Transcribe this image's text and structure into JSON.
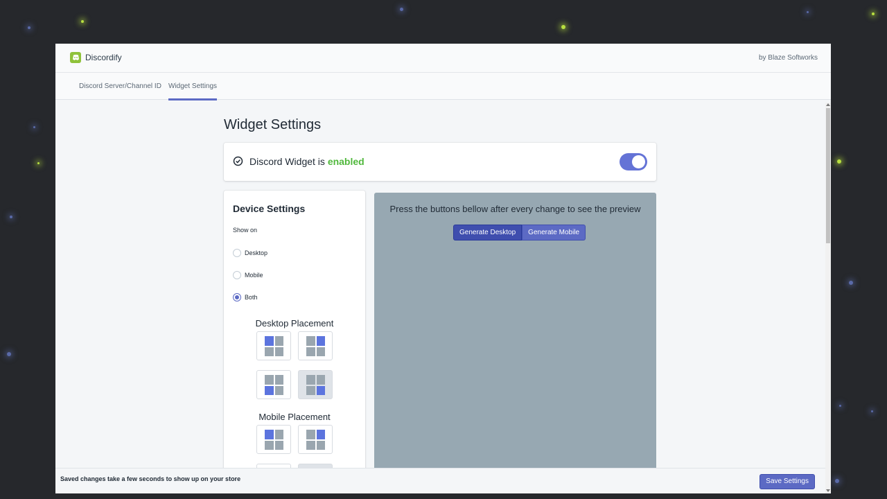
{
  "header": {
    "app_name": "Discordify",
    "app_icon": "discord-logo-icon",
    "byline": "by Blaze Softworks"
  },
  "tabs": [
    {
      "label": "Discord Server/Channel ID",
      "active": false
    },
    {
      "label": "Widget Settings",
      "active": true
    }
  ],
  "page": {
    "title": "Widget Settings"
  },
  "status": {
    "icon": "check-circle-icon",
    "prefix": "Discord Widget is",
    "value": "enabled",
    "value_color": "#50b83c",
    "toggle_on": true
  },
  "device_settings": {
    "title": "Device Settings",
    "show_on_label": "Show on",
    "options": [
      {
        "label": "Desktop",
        "checked": false
      },
      {
        "label": "Mobile",
        "checked": false
      },
      {
        "label": "Both",
        "checked": true
      }
    ],
    "desktop_placement_title": "Desktop Placement",
    "mobile_placement_title": "Mobile Placement",
    "desktop_placements": [
      {
        "name": "top-left",
        "selected": false
      },
      {
        "name": "top-right",
        "selected": false
      },
      {
        "name": "bottom-left",
        "selected": false
      },
      {
        "name": "bottom-right",
        "selected": true
      }
    ],
    "mobile_placements": [
      {
        "name": "top-left",
        "selected": false
      },
      {
        "name": "top-right",
        "selected": false
      }
    ]
  },
  "preview": {
    "hint": "Press the buttons bellow after every change to see the preview",
    "generate_desktop": "Generate Desktop",
    "generate_mobile": "Generate Mobile"
  },
  "footer": {
    "note": "Saved changes take a few seconds to show up on your store",
    "save_label": "Save Settings"
  },
  "colors": {
    "accent": "#5c6ac4",
    "brand": "#8fc23b",
    "placement_active": "#5c74de",
    "preview_bg": "#97a8b2"
  }
}
